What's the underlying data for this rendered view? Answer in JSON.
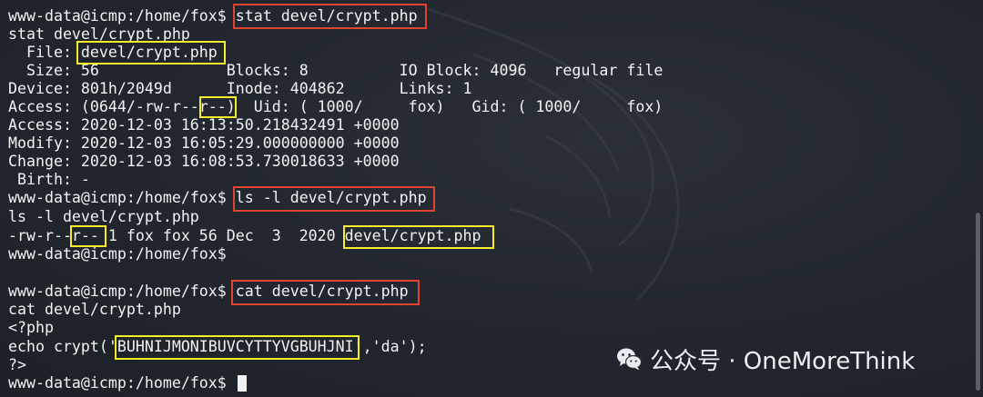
{
  "terminal": {
    "lines": [
      "www-data@icmp:/home/fox$ stat devel/crypt.php",
      "stat devel/crypt.php",
      "  File: devel/crypt.php",
      "  Size: 56          \tBlocks: 8          IO Block: 4096   regular file",
      "Device: 801h/2049d\tInode: 404862      Links: 1",
      "Access: (0644/-rw-r--r--)  Uid: ( 1000/     fox)   Gid: ( 1000/     fox)",
      "Access: 2020-12-03 16:13:50.218432491 +0000",
      "Modify: 2020-12-03 16:05:29.000000000 +0000",
      "Change: 2020-12-03 16:08:53.730018633 +0000",
      " Birth: -",
      "www-data@icmp:/home/fox$ ls -l devel/crypt.php",
      "ls -l devel/crypt.php",
      "-rw-r--r-- 1 fox fox 56 Dec  3  2020 devel/crypt.php",
      "www-data@icmp:/home/fox$ ",
      "",
      "www-data@icmp:/home/fox$ cat devel/crypt.php",
      "cat devel/crypt.php",
      "<?php",
      "echo crypt('BUHNIJMONIBUVCYTTYVGBUHJNI','da');",
      "?>",
      "www-data@icmp:/home/fox$ "
    ],
    "colors": {
      "text": "#f2f2f2",
      "background": "#1e2229",
      "red_highlight": "#e0442e",
      "yellow_highlight": "#f5ec2a"
    }
  },
  "watermark": {
    "icon": "wechat-icon",
    "text": "公众号 · OneMoreThink"
  }
}
